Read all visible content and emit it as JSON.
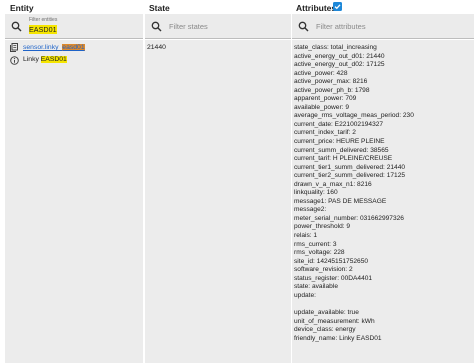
{
  "headers": {
    "entity": "Entity",
    "state": "State",
    "attributes": "Attributes"
  },
  "filters": {
    "entity_label": "Filter entities",
    "entity_value": "EASD01",
    "state_placeholder": "Filter states",
    "attributes_placeholder": "Filter attributes"
  },
  "entity": {
    "id_prefix": "sensor.linky_",
    "id_highlight": "easd01",
    "name_prefix": "Linky ",
    "name_highlight": "EASD01"
  },
  "state": "21440",
  "attributes_checked": true,
  "attributes": [
    "state_class: total_increasing",
    "active_energy_out_d01: 21440",
    "active_energy_out_d02: 17125",
    "active_power: 428",
    "active_power_max: 8216",
    "active_power_ph_b: 1798",
    "apparent_power: 709",
    "available_power: 9",
    "average_rms_voltage_meas_period: 230",
    "current_date: E221002194327",
    "current_index_tarif: 2",
    "current_price: HEURE PLEINE",
    "current_summ_delivered: 38565",
    "current_tarif: H PLEINE/CREUSE",
    "current_tier1_summ_delivered: 21440",
    "current_tier2_summ_delivered: 17125",
    "drawn_v_a_max_n1: 8216",
    "linkquality: 160",
    "message1: PAS DE MESSAGE",
    "message2:",
    "meter_serial_number: 031662997326",
    "power_threshold: 9",
    "relais: 1",
    "rms_current: 3",
    "rms_voltage: 228",
    "site_id: 14245151752650",
    "software_revision: 2",
    "status_register: 00DA4401",
    "state: available",
    "update:",
    "",
    "update_available: true",
    "unit_of_measurement: kWh",
    "device_class: energy",
    "friendly_name: Linky EASD01"
  ],
  "icons": {
    "search": "search-icon",
    "entity_list": "entity-list-icon",
    "info": "info-icon",
    "checkbox": "checkbox-checked-icon"
  },
  "colors": {
    "highlight_yellow": "#f5e500",
    "highlight_orange": "#e08a2a",
    "link_blue": "#1e63c8",
    "checkbox_blue": "#1e88d8",
    "panel_gray": "#ececec"
  }
}
